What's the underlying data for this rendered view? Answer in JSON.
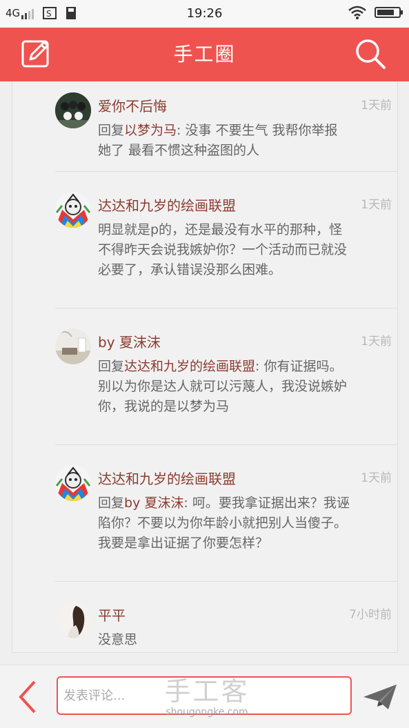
{
  "status_bar": {
    "network": "4G",
    "time": "19:26"
  },
  "header": {
    "title": "手工圈",
    "left_icon": "edit-icon",
    "right_icon": "search-icon"
  },
  "comments": [
    {
      "user": "爱你不后悔",
      "time": "1天前",
      "reply_prefix": "回复",
      "reply_to": "以梦为马",
      "text": ": 没事 不要生气 我帮你举报她了 最看不惯这种盗图的人"
    },
    {
      "user": "达达和九岁的绘画联盟",
      "time": "1天前",
      "reply_prefix": "",
      "reply_to": "",
      "text": "明显就是p的，还是最没有水平的那种，怪不得昨天会说我嫉妒你？一个活动而已就没必要了，承认错误没那么困难。"
    },
    {
      "user": "by 夏沫沫",
      "time": "1天前",
      "reply_prefix": "回复",
      "reply_to": "达达和九岁的绘画联盟",
      "text": ": 你有证据吗。别以为你是达人就可以污蔑人，我没说嫉妒你，我说的是以梦为马"
    },
    {
      "user": "达达和九岁的绘画联盟",
      "time": "1天前",
      "reply_prefix": "回复",
      "reply_to": "by 夏沫沫",
      "text": ": 呵。要我拿证据出来？我诬陷你？不要以为你年龄小就把别人当傻子。我要是拿出证据了你要怎样？"
    },
    {
      "user": "平平",
      "time": "7小时前",
      "reply_prefix": "",
      "reply_to": "",
      "text": "没意思"
    }
  ],
  "bottom_bar": {
    "placeholder": "发表评论...",
    "watermark_main": "手工客",
    "watermark_sub": "shougongke.com"
  },
  "colors": {
    "accent": "#ef5350",
    "username": "#8c3b30",
    "text": "#666666",
    "time": "#b8b8b8"
  }
}
